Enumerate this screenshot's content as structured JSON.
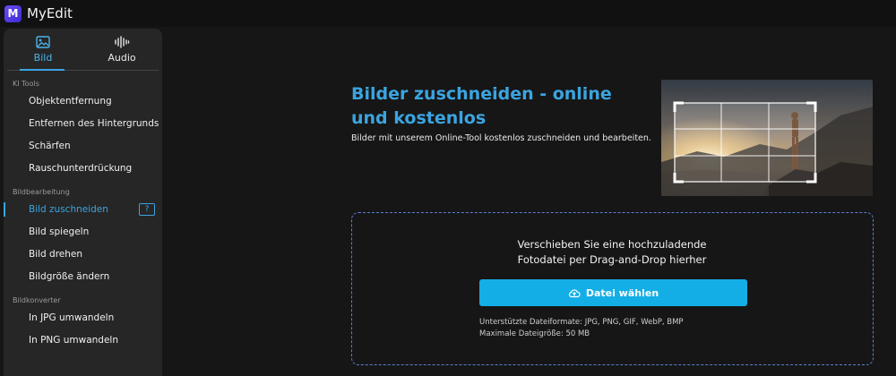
{
  "app": {
    "brand": "MyEdit",
    "logo_letter": "M",
    "accent": "#3ba4e0"
  },
  "sidebar": {
    "tabs": [
      {
        "label": "Bild",
        "icon": "image-icon",
        "active": true
      },
      {
        "label": "Audio",
        "icon": "audio-wave-icon",
        "active": false
      }
    ],
    "sections": [
      {
        "label": "KI Tools",
        "items": [
          "Objektentfernung",
          "Entfernen des Hintergrunds",
          "Schärfen",
          "Rauschunterdrückung"
        ]
      },
      {
        "label": "Bildbearbeitung",
        "items": [
          "Bild zuschneiden",
          "Bild spiegeln",
          "Bild drehen",
          "Bildgröße ändern"
        ]
      },
      {
        "label": "Bildkonverter",
        "items": [
          "In JPG umwandeln",
          "In PNG umwandeln"
        ]
      }
    ],
    "active_item": "Bild zuschneiden",
    "help_icon": "?"
  },
  "hero": {
    "title": "Bilder zuschneiden - online und kostenlos",
    "subtitle": "Bilder mit unserem Online-Tool kostenlos zuschneiden und bearbeiten."
  },
  "upload": {
    "drop_text_line1": "Verschieben Sie eine hochzuladende",
    "drop_text_line2": "Fotodatei per Drag-and-Drop hierher",
    "button_label": "Datei wählen",
    "formats": "Unterstützte Dateiformate: JPG, PNG, GIF, WebP, BMP",
    "max_size": "Maximale Dateigröße: 50 MB"
  }
}
